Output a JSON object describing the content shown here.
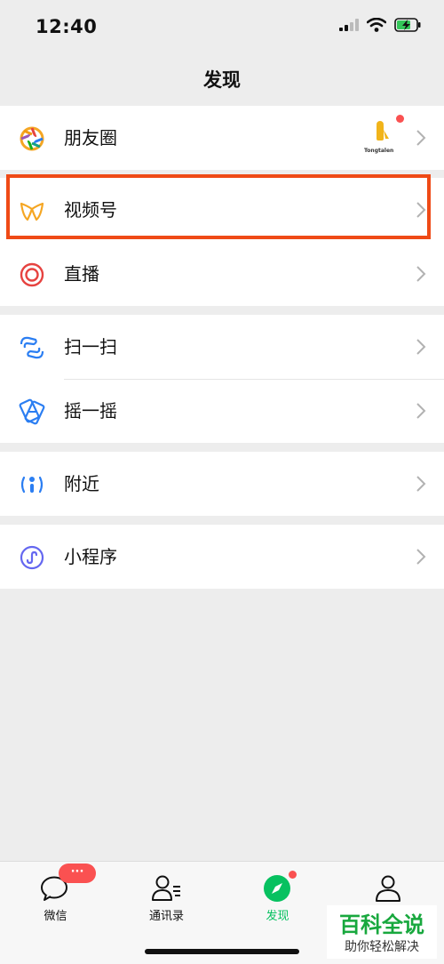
{
  "status_bar": {
    "time": "12:40"
  },
  "nav": {
    "title": "发现"
  },
  "menu": {
    "moments": {
      "label": "朋友圈",
      "thumb_caption": "Tongtalen"
    },
    "channels": {
      "label": "视频号"
    },
    "live": {
      "label": "直播"
    },
    "scan": {
      "label": "扫一扫"
    },
    "shake": {
      "label": "摇一摇"
    },
    "nearby": {
      "label": "附近"
    },
    "mini_programs": {
      "label": "小程序"
    }
  },
  "tabbar": {
    "chats": {
      "label": "微信",
      "badge": "···"
    },
    "contacts": {
      "label": "通讯录"
    },
    "discover": {
      "label": "发现"
    },
    "me": {
      "label": ""
    }
  },
  "watermark": {
    "main": "百科全说",
    "sub": "助你轻松解决"
  },
  "colors": {
    "accent_green": "#07c160",
    "badge_red": "#fa5151",
    "highlight_box": "#ef4a16"
  }
}
